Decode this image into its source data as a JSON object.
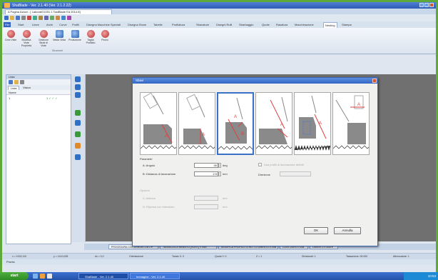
{
  "window": {
    "title": "ShaBlade - Ver. 2.1.40 (Ver. 2.1.2.22)",
    "doc_tab": "A Pagina Azioni - [ LaboratG1001.1 TastBlade Ed 2014.8]"
  },
  "menus": [
    "File",
    "Start",
    "Linee",
    "Archi",
    "Curve",
    "Profili",
    "Disegna Macchine Speciali",
    "Disegna Stone",
    "Tabelle",
    "Profilatura",
    "Sbavature",
    "Disegni Rulli",
    "Sbarbaggio",
    "Quote",
    "Rasatura",
    "Macchinazione",
    "Nesting",
    "Stampa"
  ],
  "active_menu": "Nesting",
  "ribbon": {
    "buttons": [
      "Crea Viste",
      "Modifica Viste Proprietà",
      "Gestione Strati di Viste",
      "Nesta Vista",
      "Produzione",
      "Taglia Profilato",
      "Pezzo"
    ],
    "group_label": "Strumenti"
  },
  "left_panel": {
    "title": "Lista",
    "tabs": [
      "Lista",
      "Vision"
    ],
    "column": "Nome",
    "row_label": "1",
    "row_values": "1   ✓ ✓ ✓"
  },
  "bottom_tabs": [
    "PROCEDURA CON ERRORI 1 di 2 ▾",
    "TASSELLA DI INNESTO [SOST.] x 4SB",
    "MODIFICA PROFILO STRETTO LIMENTO x 4SB",
    "CONTOURS x 4SB",
    "LIMENTO x 4SB ▾"
  ],
  "coordinates": [
    "x = 1002,110",
    "y = 1410,005",
    "dx = 0,0",
    "Orientazione",
    "Tarato X: 0",
    "Quota Y: 0",
    "Z = 1",
    "Divisionali: 1",
    "Tassazione: 00:000",
    "Attrezzature: 1"
  ],
  "status": "Pronto",
  "taskbar": {
    "start": "start",
    "tasks": [
      "ShaBlade - Ver. 2.1.40",
      "Immagine - Ver. 2.1.40"
    ],
    "clock": "10:53"
  },
  "dialog": {
    "title": "Sbavi",
    "selected_strategy": 3,
    "group_title": "Parametri",
    "angle_label": "A: Angolo",
    "angle_value": "30",
    "angle_unit": "deg",
    "distance_label": "B: Distanza di lavorazione",
    "distance_value": "2.5",
    "distance_unit": "mm",
    "checkbox_label": "Usa profili di lavorazione definiti",
    "direction_label": "Direzione",
    "sub_group_title": "Opzioni",
    "sub_label_1": "C: Altezza",
    "sub_label_2": "D: Ripresa con interstizio",
    "sub_unit_1": "mm",
    "sub_unit_2": "mm",
    "ok": "OK",
    "cancel": "Annulla"
  },
  "colors": {
    "accent": "#3a70c8",
    "canvas": "#707070",
    "taskbar": "#2452a8"
  }
}
